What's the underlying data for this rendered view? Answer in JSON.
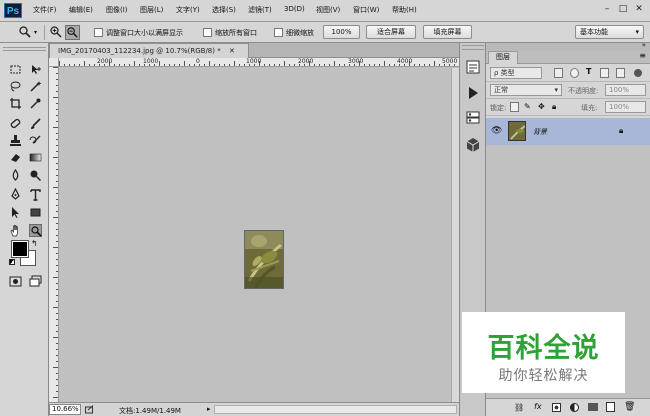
{
  "app": {
    "logo": "Ps",
    "accent": "#2c6fb8"
  },
  "menu": [
    "文件(F)",
    "编辑(E)",
    "图像(I)",
    "图层(L)",
    "文字(Y)",
    "选择(S)",
    "滤镜(T)",
    "3D(D)",
    "视图(V)",
    "窗口(W)",
    "帮助(H)"
  ],
  "window_controls": {
    "minimize": "–",
    "maximize": "□",
    "close": "✕"
  },
  "options": {
    "tool_icon": "zoom-icon",
    "resize_windows_label": "调整窗口大小以满屏显示",
    "zoom_all_label": "缩放所有窗口",
    "scrubby_label": "细微缩放",
    "btn_100": "100%",
    "btn_fit": "适合屏幕",
    "btn_fill": "填充屏幕",
    "workspace": "基本功能"
  },
  "document": {
    "tab_title": "IMG_20170403_112234.jpg @ 10.7%(RGB/8) *",
    "ruler_labels": [
      "2000",
      "1000",
      "0",
      "1000",
      "2000",
      "3000",
      "4000",
      "5000"
    ],
    "zoom": "10.66%",
    "doc_info": "文档:1.49M/1.49M"
  },
  "layers_panel": {
    "tab": "图层",
    "filter_kind": "ρ 类型",
    "blend_mode": "正常",
    "opacity_label": "不透明度:",
    "opacity_value": "100%",
    "lock_label": "锁定:",
    "fill_label": "填充:",
    "fill_value": "100%",
    "layer_name": "背景",
    "selected_color": "#a8b7d8"
  },
  "watermark": {
    "title": "百科全说",
    "subtitle": "助你轻松解决",
    "color": "#2da236"
  }
}
